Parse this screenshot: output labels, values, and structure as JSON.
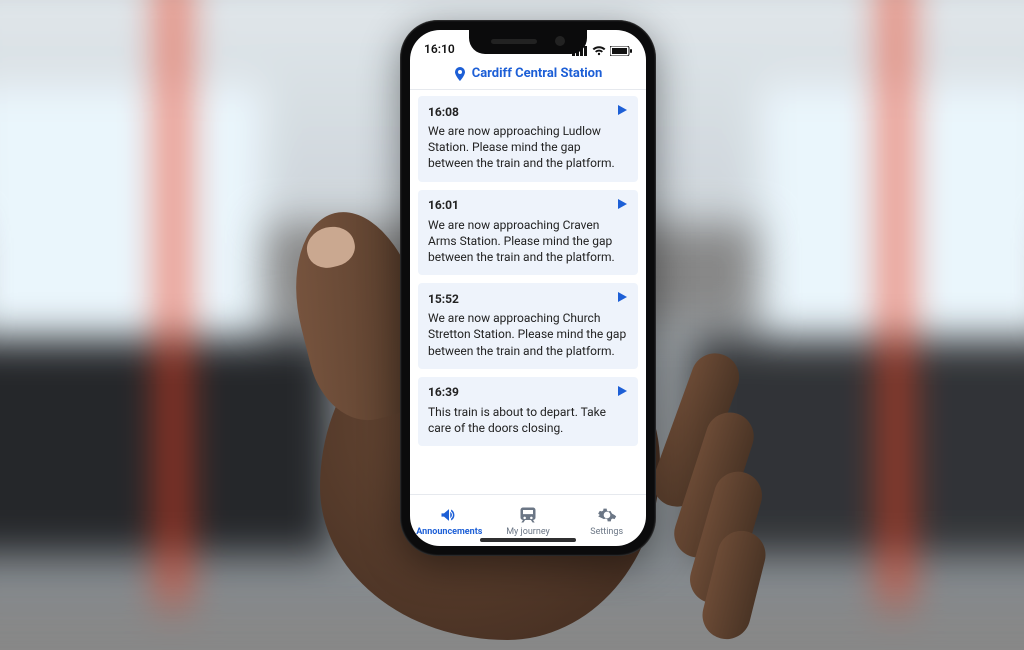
{
  "status": {
    "time": "16:10"
  },
  "header": {
    "station": "Cardiff Central Station"
  },
  "announcements": [
    {
      "time": "16:08",
      "text": "We are now approaching Ludlow Station. Please mind the gap between the train and the platform."
    },
    {
      "time": "16:01",
      "text": "We are now approaching Craven Arms Station. Please mind the gap between the train and the platform."
    },
    {
      "time": "15:52",
      "text": "We are now approaching Church Stretton Station. Please mind the gap between the train and the platform."
    },
    {
      "time": "16:39",
      "text": "This train is about to depart. Take care of the doors closing."
    }
  ],
  "tabs": {
    "announcements": "Announcements",
    "journey": "My journey",
    "settings": "Settings"
  },
  "colors": {
    "accent": "#1d5fd6",
    "card_bg": "#eef3fb"
  }
}
